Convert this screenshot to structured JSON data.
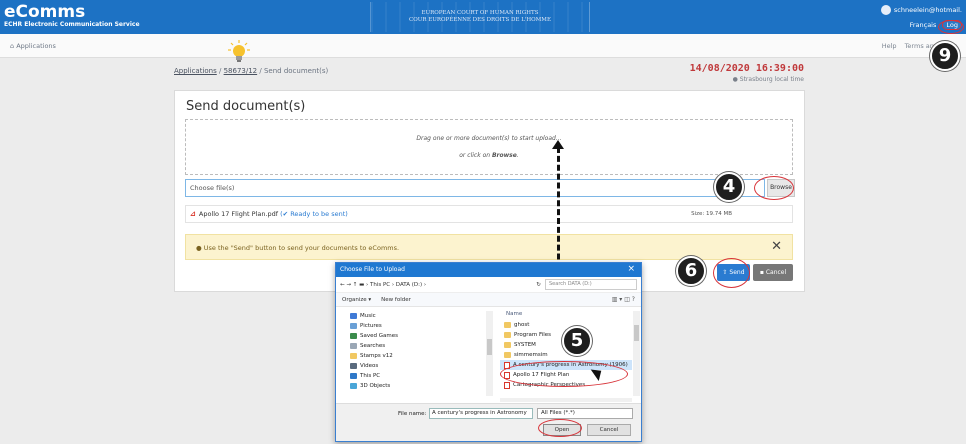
{
  "header": {
    "brand_main": "eComms",
    "brand_sub": "ECHR Electronic Communication Service",
    "court_en": "EUROPEAN COURT OF HUMAN RIGHTS",
    "court_fr": "COUR EUROPÉENNE DES DROITS DE L'HOMME",
    "user_email": "schneelein@hotmail.",
    "language": "Français",
    "logout": "Log"
  },
  "subnav": {
    "applications": "Applications",
    "help": "Help",
    "terms": "Terms and"
  },
  "breadcrumb": {
    "root": "Applications",
    "case": "58673/12",
    "current": "Send document(s)",
    "sep": "/"
  },
  "datetime": {
    "value": "14/08/2020 16:39:00",
    "zone": "Strasbourg local time"
  },
  "form": {
    "title": "Send document(s)",
    "drop_line1": "Drag one or more document(s) to start upload...",
    "drop_line2_pre": "or click on ",
    "drop_line2_em": "Browse",
    "drop_line2_post": ".",
    "choose_placeholder": "Choose file(s)",
    "browse": "Browse",
    "file_name": "Apollo 17 Flight Plan.pdf",
    "file_status": "Ready to be sent",
    "file_size": "Size: 19.74 MB",
    "notice": "Use the \"Send\" button to send your documents to eComms.",
    "close_symbol": "✕",
    "send": "Send",
    "cancel": "Cancel"
  },
  "annotations": {
    "step_browse": "4",
    "step_open": "5",
    "step_send": "6",
    "step_logout": "9"
  },
  "dialog": {
    "title": "Choose File to Upload",
    "path": "← → ↑  ▬ › This PC › DATA (D:) ›",
    "search": "Search DATA (D:)",
    "organize": "Organize ▾",
    "new_folder": "New folder",
    "list_header": "Name",
    "nav_items": [
      {
        "label": "Music",
        "color": "#3f7ad6"
      },
      {
        "label": "Pictures",
        "color": "#6aa0d6"
      },
      {
        "label": "Saved Games",
        "color": "#3b8c4c"
      },
      {
        "label": "Searches",
        "color": "#9aa7b5"
      },
      {
        "label": "Stamps v12",
        "color": "#f1c862"
      },
      {
        "label": "Videos",
        "color": "#5a6b7e"
      },
      {
        "label": "This PC",
        "color": "#2f78c8"
      },
      {
        "label": "3D Objects",
        "color": "#4aa6d8"
      }
    ],
    "files": [
      {
        "label": "ghost",
        "kind": "folder"
      },
      {
        "label": "Program Files",
        "kind": "folder"
      },
      {
        "label": "SYSTEM",
        "kind": "folder"
      },
      {
        "label": "simmemsim",
        "kind": "folder"
      },
      {
        "label": "A century's progress in Astronomy (1906)",
        "kind": "pdf"
      },
      {
        "label": "Apollo 17 Flight Plan",
        "kind": "pdf"
      },
      {
        "label": "Cartographic Perspectives",
        "kind": "pdf"
      }
    ],
    "filename_label": "File name:",
    "filename_value": "A century's progress in Astronomy",
    "filetype": "All Files (*.*)",
    "open": "Open",
    "cancel": "Cancel"
  }
}
